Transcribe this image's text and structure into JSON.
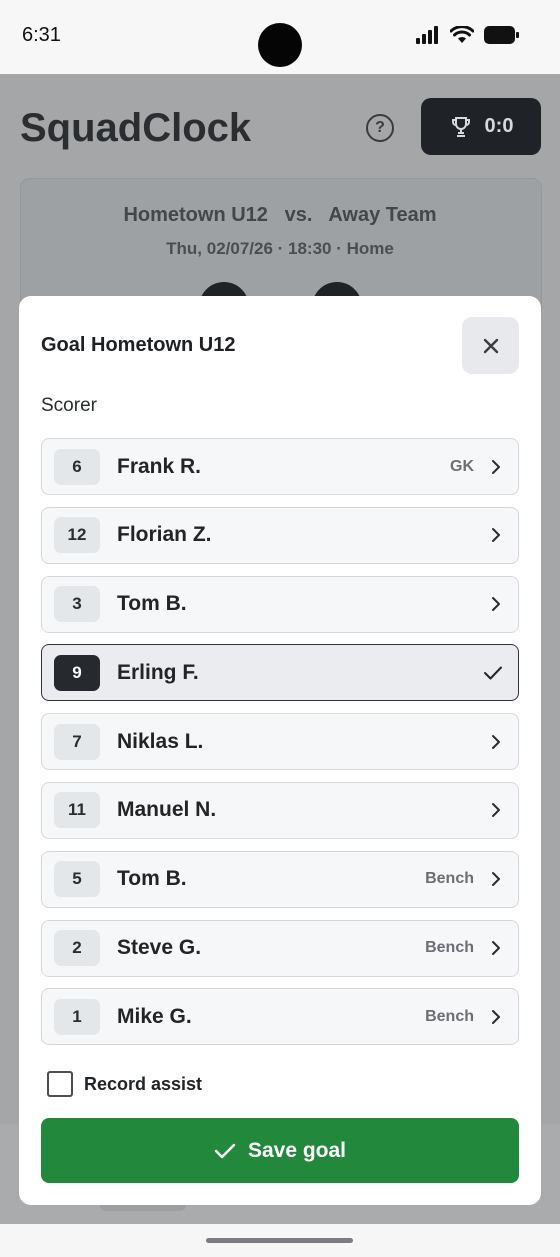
{
  "status_bar": {
    "time": "6:31"
  },
  "app": {
    "title": "SquadClock",
    "score": "0:0",
    "match": {
      "teams": "Hometown U12   vs.   Away Team",
      "meta": "Thu, 02/07/26 · 18:30 · Home"
    }
  },
  "modal": {
    "title": "Goal Hometown U12",
    "section_label": "Scorer",
    "players": [
      {
        "number": "6",
        "name": "Frank R.",
        "tag": "GK",
        "selected": false
      },
      {
        "number": "12",
        "name": "Florian Z.",
        "tag": "",
        "selected": false
      },
      {
        "number": "3",
        "name": "Tom B.",
        "tag": "",
        "selected": false
      },
      {
        "number": "9",
        "name": "Erling F.",
        "tag": "",
        "selected": true
      },
      {
        "number": "7",
        "name": "Niklas L.",
        "tag": "",
        "selected": false
      },
      {
        "number": "11",
        "name": "Manuel N.",
        "tag": "",
        "selected": false
      },
      {
        "number": "5",
        "name": "Tom B.",
        "tag": "Bench",
        "selected": false
      },
      {
        "number": "2",
        "name": "Steve G.",
        "tag": "Bench",
        "selected": false
      },
      {
        "number": "1",
        "name": "Mike G.",
        "tag": "Bench",
        "selected": false
      }
    ],
    "assist_label": "Record assist",
    "assist_checked": false,
    "save_label": "Save goal"
  },
  "colors": {
    "primary_green": "#22893c",
    "selected_badge": "#262a2e",
    "overlay_gray": "#a4a6a8"
  }
}
